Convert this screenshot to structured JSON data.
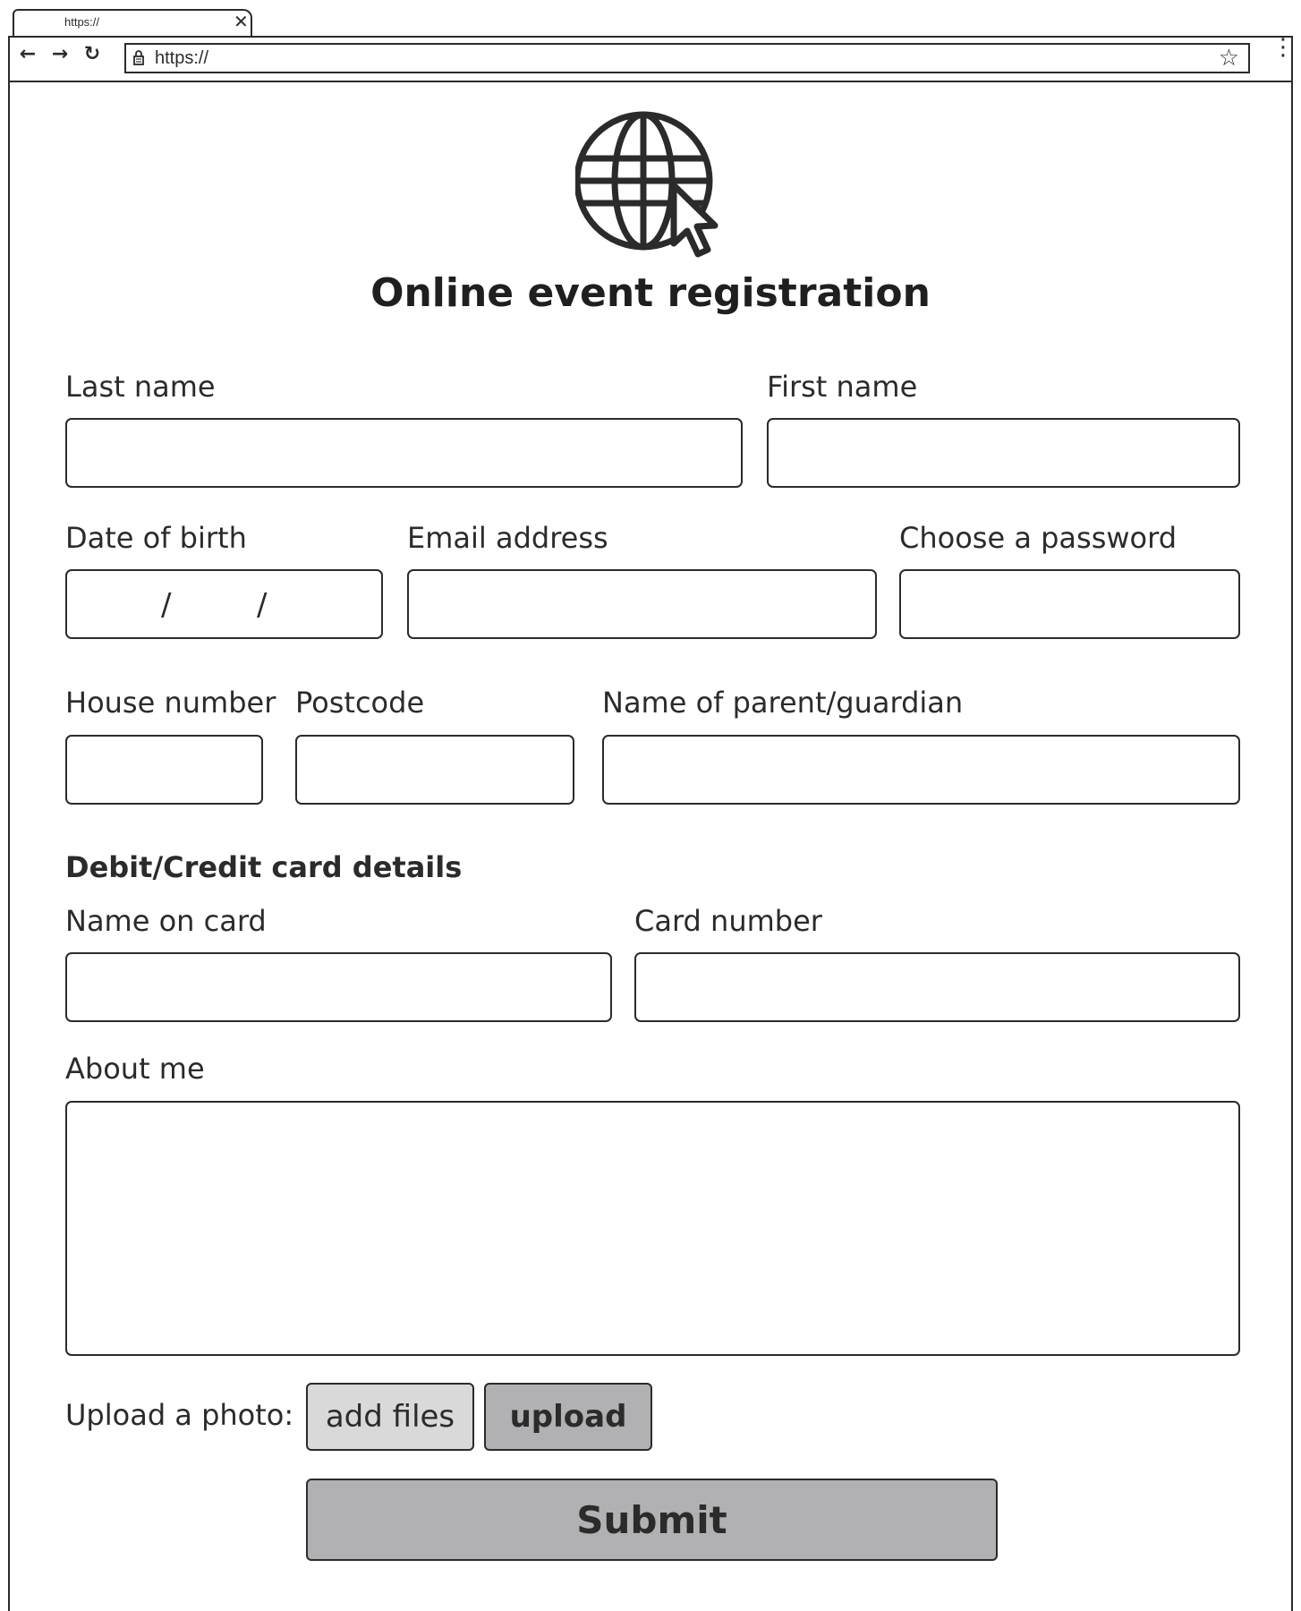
{
  "browser": {
    "tab_title": "https://",
    "tab_close": "✕",
    "back": "←",
    "forward": "→",
    "reload": "↻",
    "url": "https://",
    "star": "☆",
    "menu": "⋮"
  },
  "page": {
    "title": "Online event registration",
    "logo_icon": "globe-with-cursor-icon"
  },
  "form": {
    "last_name_label": "Last name",
    "first_name_label": "First name",
    "dob_label": "Date of birth",
    "dob_sep1": "/",
    "dob_sep2": "/",
    "email_label": "Email address",
    "password_label": "Choose a password",
    "house_number_label": "House number",
    "postcode_label": "Postcode",
    "guardian_label": "Name of parent/guardian",
    "card_section_heading": "Debit/Credit card details",
    "name_on_card_label": "Name on card",
    "card_number_label": "Card number",
    "about_label": "About me",
    "upload_label": "Upload a photo:",
    "add_files_button": "add files",
    "upload_button": "upload",
    "submit_button": "Submit"
  },
  "colors": {
    "outline": "#2b2b2b",
    "add_files_bg": "#d9d9d9",
    "upload_bg": "#b1b1b3",
    "submit_bg": "#b1b1b3"
  }
}
